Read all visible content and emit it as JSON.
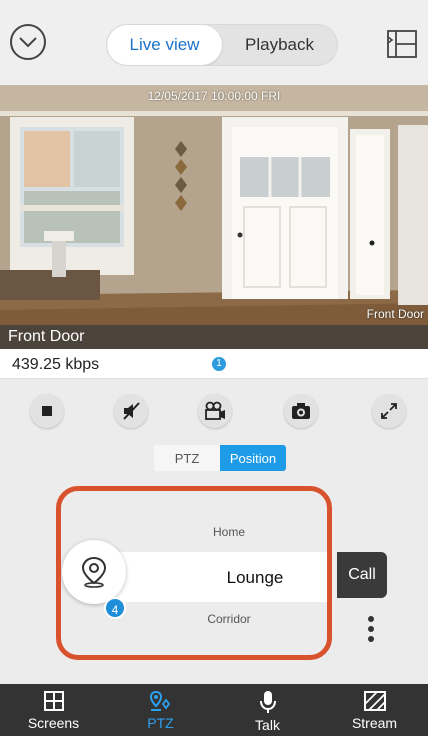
{
  "header": {
    "tabs": [
      {
        "label": "Live view",
        "active": true
      },
      {
        "label": "Playback",
        "active": false
      }
    ],
    "menu_icon": "chevron-down-circle-icon",
    "layout_icon": "split-layout-icon",
    "accent_color": "#1a73c9"
  },
  "video": {
    "timestamp": "12/05/2017 10:00:00 FRI",
    "overlay_name": "Front Door",
    "camera_title": "Front Door"
  },
  "info": {
    "bitrate": "439.25 kbps",
    "page_indicator": "1"
  },
  "controls": [
    {
      "name": "stop",
      "icon": "stop-icon"
    },
    {
      "name": "mute",
      "icon": "speaker-muted-icon"
    },
    {
      "name": "record",
      "icon": "video-camera-icon"
    },
    {
      "name": "snapshot",
      "icon": "camera-icon"
    },
    {
      "name": "fullscreen",
      "icon": "expand-icon"
    }
  ],
  "mode_tabs": [
    {
      "label": "PTZ",
      "active": false
    },
    {
      "label": "Position",
      "active": true
    }
  ],
  "position_picker": {
    "previous": "Home",
    "selected": "Lounge",
    "next": "Corridor",
    "preset_count": "4",
    "call_label": "Call",
    "highlight_color": "#d9522e"
  },
  "bottom_nav": [
    {
      "label": "Screens",
      "icon": "grid-icon",
      "active": false
    },
    {
      "label": "PTZ",
      "icon": "ptz-icon",
      "active": true
    },
    {
      "label": "Talk",
      "icon": "microphone-icon",
      "active": false
    },
    {
      "label": "Stream",
      "icon": "stream-icon",
      "active": false
    }
  ]
}
